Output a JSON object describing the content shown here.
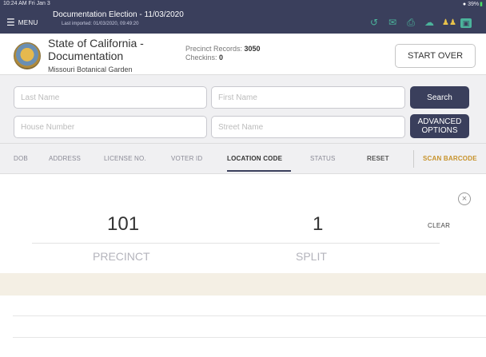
{
  "status": {
    "time": "10:24 AM  Fri Jan 3",
    "battery": "39%",
    "wifi_icon": "wifi-icon",
    "battery_icon": "battery-icon"
  },
  "topbar": {
    "menu_label": "MENU",
    "title": "Documentation Election - 11/03/2020",
    "subtitle": "Last imported: 01/03/2020, 09:49:20",
    "icons": [
      "history-icon",
      "mail-icon",
      "printer-icon",
      "cloud-upload-icon",
      "users-icon",
      "screen-icon"
    ]
  },
  "header": {
    "org_name": "State of California - Documentation",
    "site": "Missouri Botanical Garden",
    "precinct_records_label": "Precinct Records: ",
    "precinct_records_value": "3050",
    "checkins_label": "Checkins: ",
    "checkins_value": "0",
    "start_over_label": "START OVER"
  },
  "search": {
    "last_name_placeholder": "Last Name",
    "first_name_placeholder": "First Name",
    "house_number_placeholder": "House Number",
    "street_name_placeholder": "Street Name",
    "search_label": "Search",
    "advanced_label": "ADVANCED OPTIONS"
  },
  "tabs": {
    "items": [
      "DOB",
      "ADDRESS",
      "LICENSE NO.",
      "VOTER ID",
      "LOCATION CODE",
      "STATUS"
    ],
    "active": "LOCATION CODE",
    "reset": "RESET",
    "scan": "SCAN BARCODE"
  },
  "location_code": {
    "precinct_value": "101",
    "precinct_caption": "PRECINCT",
    "split_value": "1",
    "split_caption": "SPLIT",
    "clear_label": "CLEAR"
  },
  "colors": {
    "topbar": "#3a3f5c",
    "accent_teal": "#4bb39b",
    "accent_gold": "#c7922a",
    "highlight_row": "#f4efe4"
  }
}
